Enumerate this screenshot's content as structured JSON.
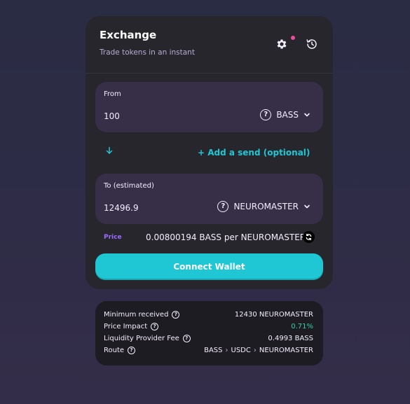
{
  "header": {
    "title": "Exchange",
    "subtitle": "Trade tokens in an instant"
  },
  "icons": {
    "settings": "gear-icon",
    "history": "history-icon",
    "help": "question-icon",
    "chevron": "chevron-down-icon",
    "arrow": "arrow-down-icon",
    "refresh": "refresh-icon"
  },
  "from": {
    "label": "From",
    "amount": "100",
    "token": "BASS"
  },
  "middle": {
    "add_send": "+ Add a send (optional)"
  },
  "to": {
    "label": "To (estimated)",
    "amount": "12496.9",
    "token": "NEUROMASTER"
  },
  "price": {
    "label": "Price",
    "value": "0.00800194 BASS per NEUROMASTER"
  },
  "connect_label": "Connect Wallet",
  "details": {
    "min_received_label": "Minimum received",
    "min_received_value": "12430 NEUROMASTER",
    "price_impact_label": "Price Impact",
    "price_impact_value": "0.71%",
    "lp_fee_label": "Liquidity Provider Fee",
    "lp_fee_value": "0.4993 BASS",
    "route_label": "Route",
    "route": [
      "BASS",
      "USDC",
      "NEUROMASTER"
    ],
    "route_sep": "›"
  },
  "colors": {
    "accent": "#1fc7d4",
    "secondary": "#9a6aff",
    "success": "#31d0aa",
    "notification": "#ed4b9e"
  }
}
